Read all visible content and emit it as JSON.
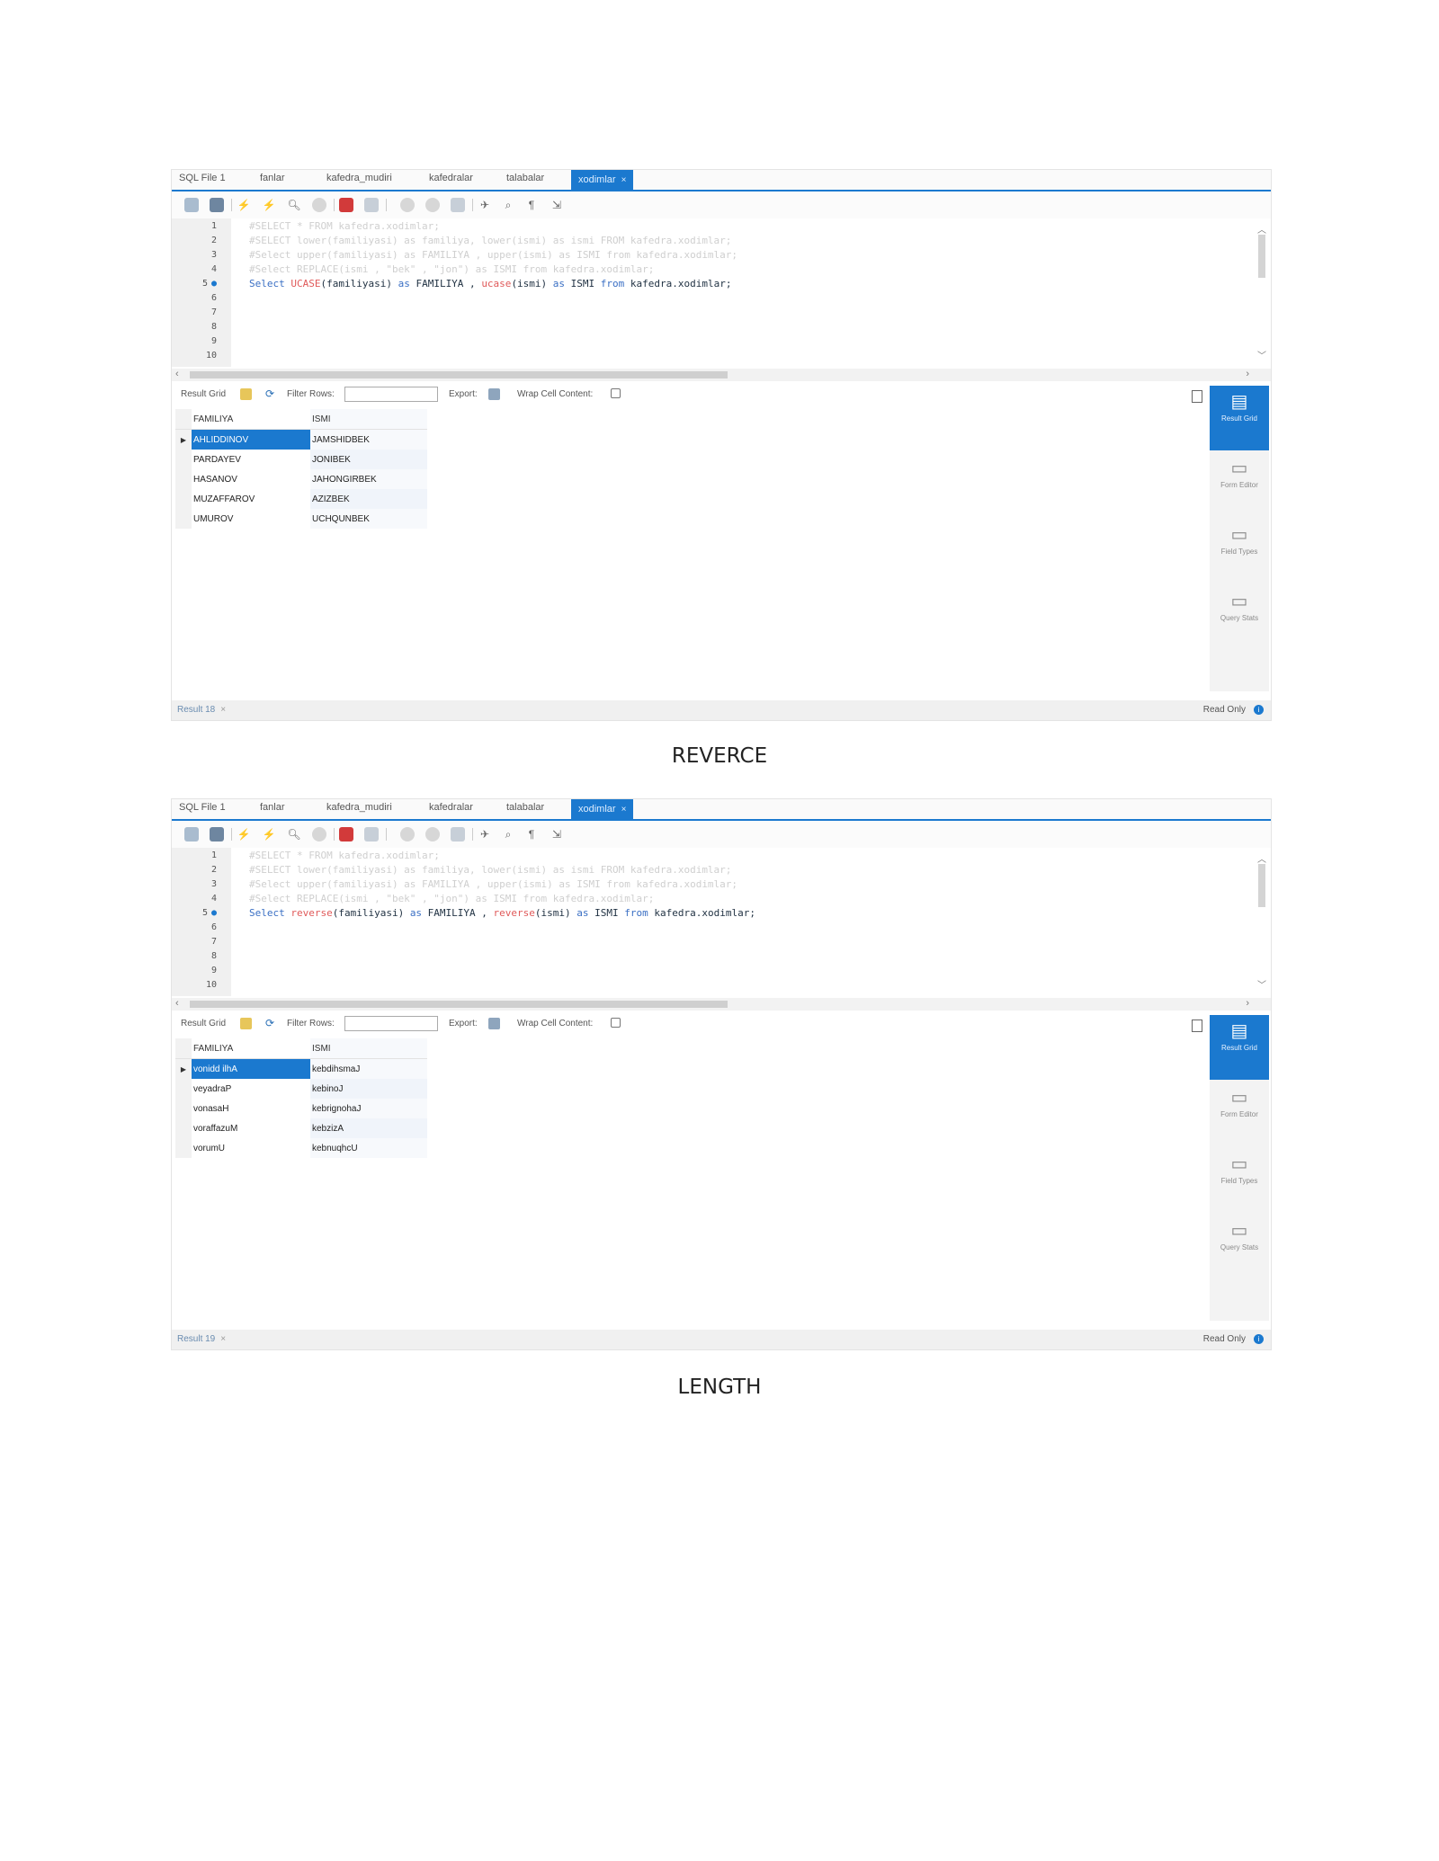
{
  "screens": [
    {
      "tabs": [
        "SQL File 1",
        "fanlar",
        "kafedra_mudiri",
        "kafedralar",
        "talabalar"
      ],
      "active_tab": "xodimlar",
      "active_tab_close": "×",
      "editor": {
        "line_numbers": [
          "1",
          "2",
          "3",
          "4",
          "5",
          "6",
          "7",
          "8",
          "9",
          "10"
        ],
        "comment_lines": [
          "#SELECT * FROM kafedra.xodimlar;",
          "#SELECT lower(familiyasi) as familiya, lower(ismi) as ismi FROM kafedra.xodimlar;",
          "#Select upper(familiyasi) as FAMILIYA , upper(ismi) as ISMI from kafedra.xodimlar;",
          "#Select REPLACE(ismi , \"bek\" , \"jon\") as ISMI from kafedra.xodimlar;"
        ],
        "query": {
          "p1": "Select ",
          "f1": "UCASE",
          "p2": "(familiyasi) ",
          "k1": "as",
          "p3": " FAMILIYA , ",
          "f2": "ucase",
          "p4": "(ismi) ",
          "k2": "as",
          "p5": " ISMI ",
          "k3": "from",
          "p6": " kafedra.xodimlar;"
        }
      },
      "result_toolbar": {
        "result_grid": "Result Grid",
        "filter_rows": "Filter Rows:",
        "export": "Export:",
        "wrap": "Wrap Cell Content:"
      },
      "grid": {
        "columns": [
          "FAMILIYA",
          "ISMI"
        ],
        "rows": [
          [
            "AHLIDDINOV",
            "JAMSHIDBEK"
          ],
          [
            "PARDAYEV",
            "JONIBEK"
          ],
          [
            "HASANOV",
            "JAHONGIRBEK"
          ],
          [
            "MUZAFFAROV",
            "AZIZBEK"
          ],
          [
            "UMUROV",
            "UCHQUNBEK"
          ]
        ]
      },
      "side_panel": [
        "Result Grid",
        "Form Editor",
        "Field Types",
        "Query Stats"
      ],
      "status": {
        "result": "Result 18",
        "close": "×",
        "readonly": "Read Only"
      }
    },
    {
      "tabs": [
        "SQL File 1",
        "fanlar",
        "kafedra_mudiri",
        "kafedralar",
        "talabalar"
      ],
      "active_tab": "xodimlar",
      "active_tab_close": "×",
      "editor": {
        "line_numbers": [
          "1",
          "2",
          "3",
          "4",
          "5",
          "6",
          "7",
          "8",
          "9",
          "10"
        ],
        "comment_lines": [
          "#SELECT * FROM kafedra.xodimlar;",
          "#SELECT lower(familiyasi) as familiya, lower(ismi) as ismi FROM kafedra.xodimlar;",
          "#Select upper(familiyasi) as FAMILIYA , upper(ismi) as ISMI from kafedra.xodimlar;",
          "#Select REPLACE(ismi , \"bek\" , \"jon\") as ISMI from kafedra.xodimlar;"
        ],
        "query": {
          "p1": "Select ",
          "f1": "reverse",
          "p2": "(familiyasi) ",
          "k1": "as",
          "p3": " FAMILIYA , ",
          "f2": "reverse",
          "p4": "(ismi) ",
          "k2": "as",
          "p5": " ISMI ",
          "k3": "from",
          "p6": " kafedra.xodimlar;"
        }
      },
      "result_toolbar": {
        "result_grid": "Result Grid",
        "filter_rows": "Filter Rows:",
        "export": "Export:",
        "wrap": "Wrap Cell Content:"
      },
      "grid": {
        "columns": [
          "FAMILIYA",
          "ISMI"
        ],
        "rows": [
          [
            "vonidd ilhA",
            "kebdihsmaJ"
          ],
          [
            "veyadraP",
            "kebinoJ"
          ],
          [
            "vonasaH",
            "kebrignohaJ"
          ],
          [
            "voraffazuM",
            "kebzizA"
          ],
          [
            "vorumU",
            "kebnuqhcU"
          ]
        ]
      },
      "side_panel": [
        "Result Grid",
        "Form Editor",
        "Field Types",
        "Query Stats"
      ],
      "status": {
        "result": "Result 19",
        "close": "×",
        "readonly": "Read Only"
      }
    }
  ],
  "captions": [
    "REVERCE",
    "LENGTH"
  ],
  "icons": [
    "folder-icon",
    "save-icon",
    "execute-icon",
    "execute-current-icon",
    "explain-icon",
    "stop-icon",
    "toggle-error-icon",
    "commit-icon",
    "rollback-icon",
    "autocommit-icon",
    "beautify-icon",
    "find-icon",
    "invisible-chars-icon",
    "wrap-icon"
  ]
}
